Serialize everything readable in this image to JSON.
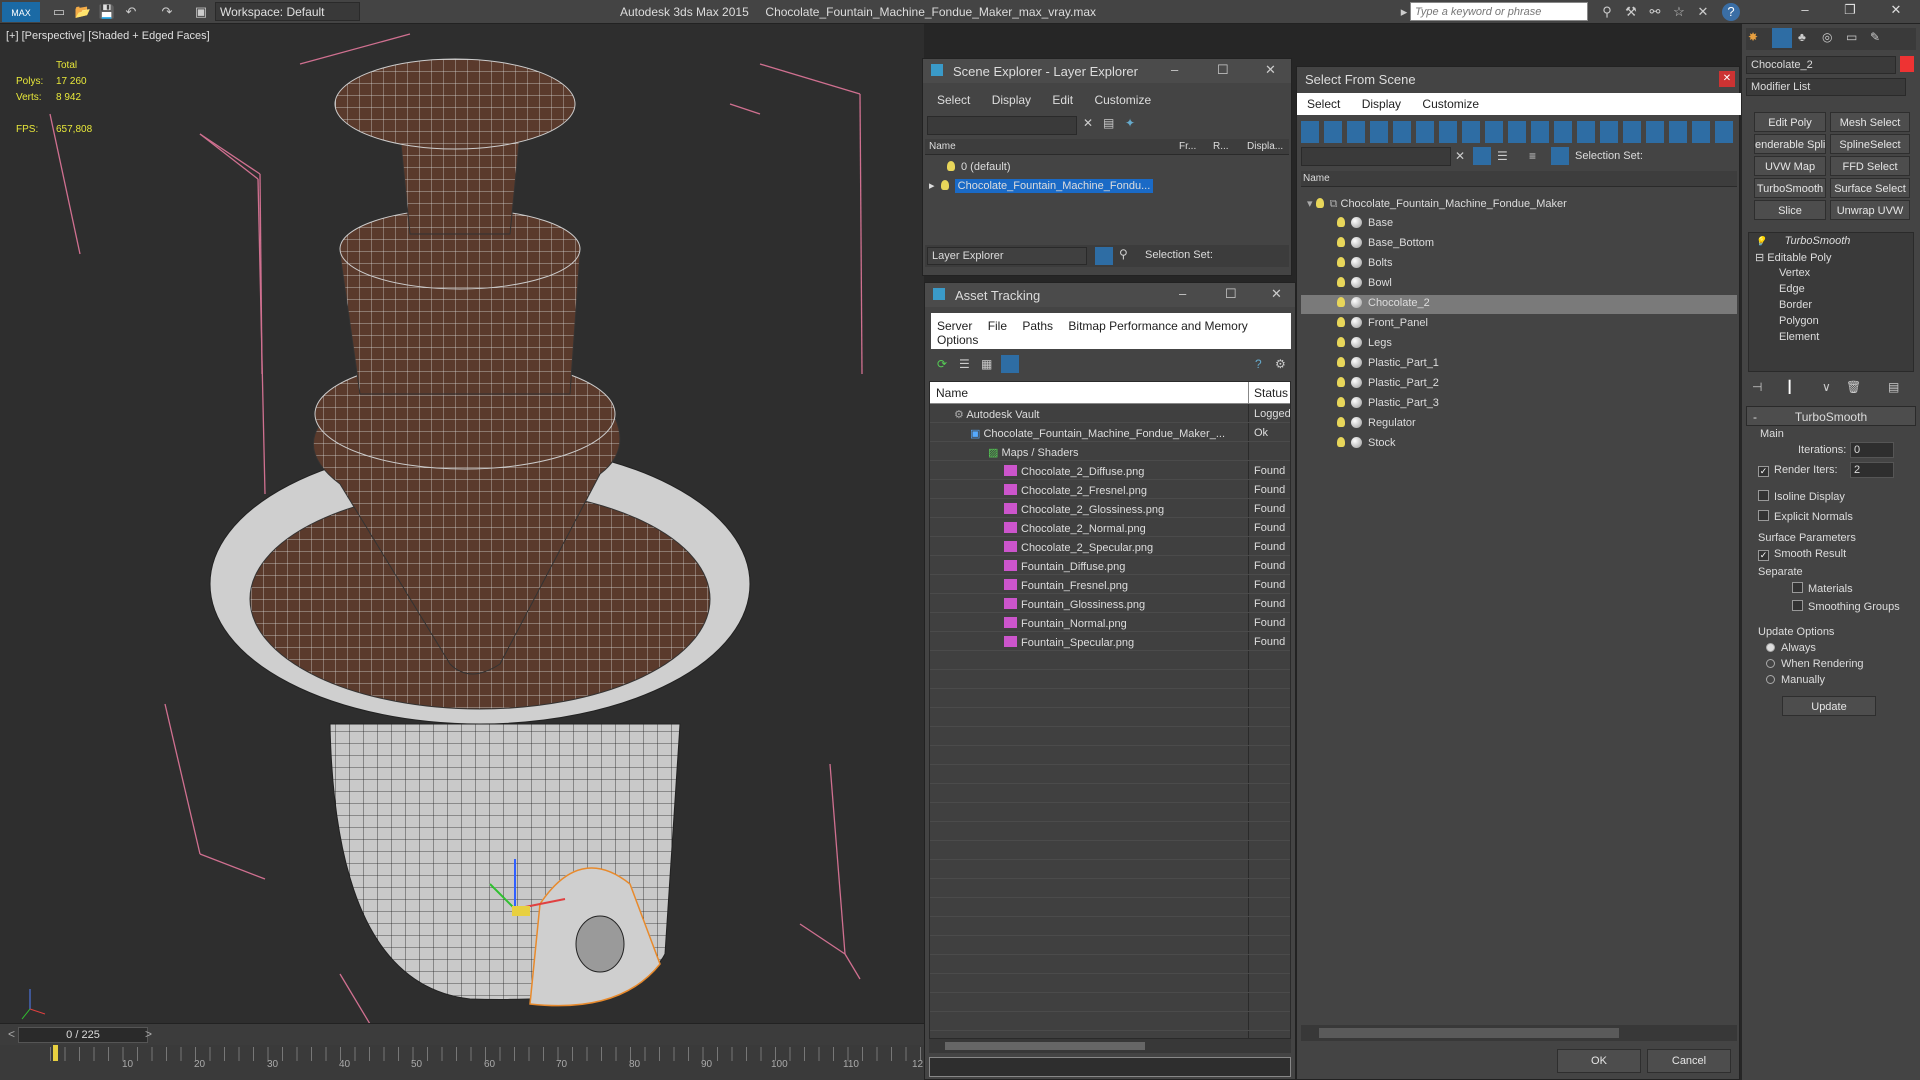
{
  "app": {
    "title": "Autodesk 3ds Max  2015",
    "file": "Chocolate_Fountain_Machine_Fondue_Maker_max_vray.max",
    "logo": "MAX",
    "workspace": "Workspace: Default",
    "search_placeholder": "Type a keyword or phrase"
  },
  "viewport": {
    "label": "[+] [Perspective] [Shaded + Edged Faces]",
    "stats_total": "Total",
    "polys_label": "Polys:",
    "polys": "17 260",
    "verts_label": "Verts:",
    "verts": "8 942",
    "fps_label": "FPS:",
    "fps": "657,808"
  },
  "timeline": {
    "frame": "0 / 225",
    "ticks": [
      "10",
      "20",
      "30",
      "40",
      "50",
      "60",
      "70",
      "80",
      "90",
      "100",
      "110",
      "12"
    ]
  },
  "scene_explorer": {
    "title": "Scene Explorer - Layer Explorer",
    "menu": [
      "Select",
      "Display",
      "Edit",
      "Customize"
    ],
    "cols": [
      "Name",
      "Fr...",
      "R...",
      "Displa..."
    ],
    "rows": [
      "0 (default)",
      "Chocolate_Fountain_Machine_Fondu..."
    ],
    "footer_label": "Layer Explorer",
    "selection_set": "Selection Set:"
  },
  "asset_tracking": {
    "title": "Asset Tracking",
    "menu": [
      "Server",
      "File",
      "Paths",
      "Bitmap Performance and Memory"
    ],
    "menu2": "Options",
    "col_name": "Name",
    "col_status": "Status",
    "rows": [
      {
        "name": "Autodesk Vault",
        "status": "Logged"
      },
      {
        "name": "Chocolate_Fountain_Machine_Fondue_Maker_...",
        "status": "Ok"
      },
      {
        "name": "Maps / Shaders",
        "status": ""
      },
      {
        "name": "Chocolate_2_Diffuse.png",
        "status": "Found"
      },
      {
        "name": "Chocolate_2_Fresnel.png",
        "status": "Found"
      },
      {
        "name": "Chocolate_2_Glossiness.png",
        "status": "Found"
      },
      {
        "name": "Chocolate_2_Normal.png",
        "status": "Found"
      },
      {
        "name": "Chocolate_2_Specular.png",
        "status": "Found"
      },
      {
        "name": "Fountain_Diffuse.png",
        "status": "Found"
      },
      {
        "name": "Fountain_Fresnel.png",
        "status": "Found"
      },
      {
        "name": "Fountain_Glossiness.png",
        "status": "Found"
      },
      {
        "name": "Fountain_Normal.png",
        "status": "Found"
      },
      {
        "name": "Fountain_Specular.png",
        "status": "Found"
      }
    ]
  },
  "select_from_scene": {
    "title": "Select From Scene",
    "menu": [
      "Select",
      "Display",
      "Customize"
    ],
    "selection_set": "Selection Set:",
    "col_name": "Name",
    "root": "Chocolate_Fountain_Machine_Fondue_Maker",
    "items": [
      "Base",
      "Base_Bottom",
      "Bolts",
      "Bowl",
      "Chocolate_2",
      "Front_Panel",
      "Legs",
      "Plastic_Part_1",
      "Plastic_Part_2",
      "Plastic_Part_3",
      "Regulator",
      "Stock"
    ],
    "ok": "OK",
    "cancel": "Cancel"
  },
  "command_panel": {
    "object_name": "Chocolate_2",
    "modifier_list": "Modifier List",
    "buttons": [
      "Edit Poly",
      "Mesh Select",
      "enderable Splir",
      "SplineSelect",
      "UVW Map",
      "FFD Select",
      "TurboSmooth",
      "Surface Select",
      "Slice",
      "Unwrap UVW"
    ],
    "stack": [
      "TurboSmooth",
      "Editable Poly",
      "Vertex",
      "Edge",
      "Border",
      "Polygon",
      "Element"
    ],
    "rollout_title": "TurboSmooth",
    "main": "Main",
    "iterations_label": "Iterations:",
    "iterations": "0",
    "render_iters_label": "Render Iters:",
    "render_iters": "2",
    "isoline": "Isoline Display",
    "explicit": "Explicit Normals",
    "surface_params": "Surface Parameters",
    "smooth_result": "Smooth Result",
    "separate": "Separate",
    "materials": "Materials",
    "smoothing_groups": "Smoothing Groups",
    "update_options": "Update Options",
    "always": "Always",
    "when_rendering": "When Rendering",
    "manually": "Manually",
    "update": "Update"
  }
}
